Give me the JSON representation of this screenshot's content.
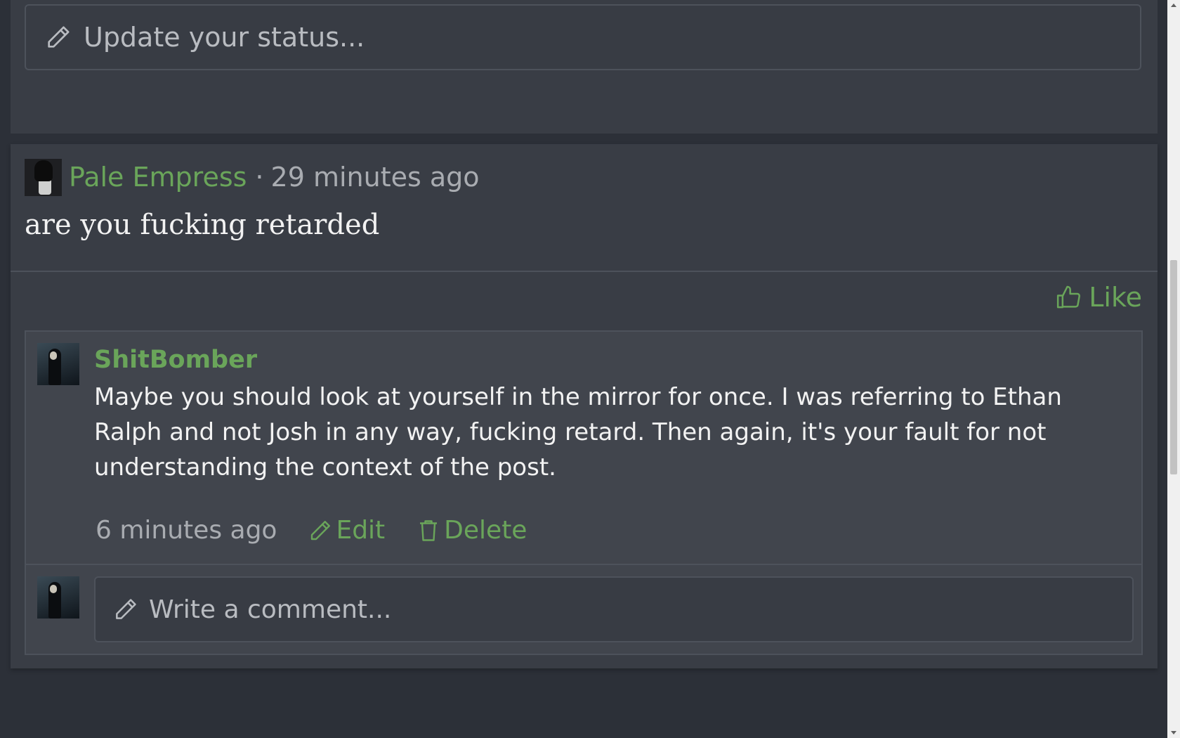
{
  "status": {
    "placeholder": "Update your status..."
  },
  "post": {
    "author": "Pale Empress",
    "separator": "·",
    "time": "29 minutes ago",
    "body": "are you fucking retarded",
    "like_label": "Like"
  },
  "comment": {
    "author": "ShitBomber",
    "text": "Maybe you should look at yourself in the mirror for once. I was referring to Ethan Ralph and not Josh in any way, fucking retard. Then again, it's your fault for not understanding the context of the post.",
    "time": "6 minutes ago",
    "edit_label": "Edit",
    "delete_label": "Delete"
  },
  "write_comment": {
    "placeholder": "Write a comment..."
  },
  "colors": {
    "accent": "#6aa55a",
    "background": "#2c3038",
    "panel": "#393d45"
  },
  "icons": [
    "pencil-icon",
    "thumbs-up-icon",
    "trash-icon"
  ]
}
